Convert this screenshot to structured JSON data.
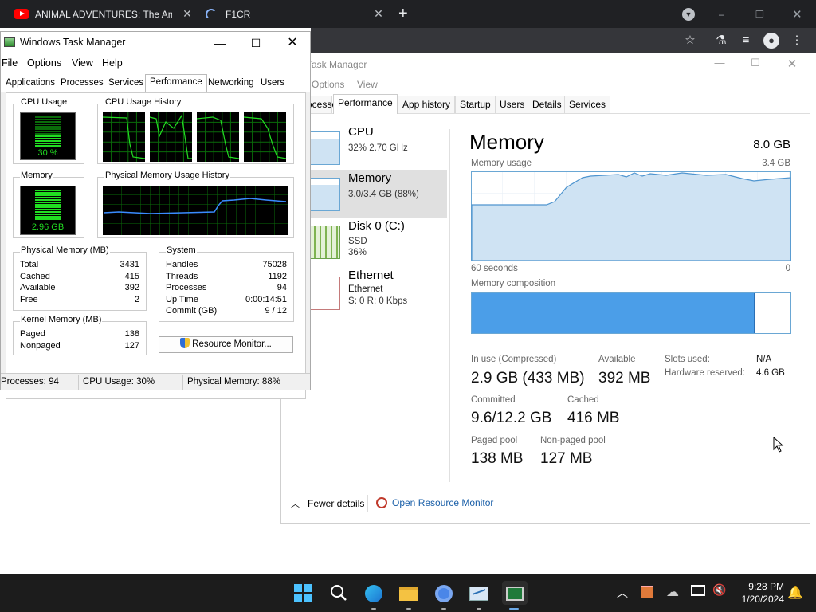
{
  "chrome": {
    "tabs": [
      {
        "label": "ANIMAL ADVENTURES: The Ama",
        "icon": "youtube-icon"
      },
      {
        "label": "F1CR",
        "icon": "loading-spinner-icon"
      }
    ],
    "new_tab_symbol": "+",
    "window_controls": [
      "–",
      "❐",
      "✕"
    ]
  },
  "ntm": {
    "title": "Task Manager",
    "menu": [
      "Options",
      "View"
    ],
    "tabs": [
      "Processes",
      "Performance",
      "App history",
      "Startup",
      "Users",
      "Details",
      "Services"
    ],
    "active_tab": "Performance",
    "sidebar": [
      {
        "name": "CPU",
        "sub1": "32%  2.70 GHz",
        "sub2": ""
      },
      {
        "name": "Memory",
        "sub1": "3.0/3.4 GB (88%)",
        "sub2": ""
      },
      {
        "name": "Disk 0 (C:)",
        "sub1": "SSD",
        "sub2": "36%"
      },
      {
        "name": "Ethernet",
        "sub1": "Ethernet",
        "sub2": "S: 0  R: 0 Kbps"
      }
    ],
    "heading": "Memory",
    "total": "8.0 GB",
    "usage_label": "Memory usage",
    "usage_max": "3.4 GB",
    "time_left": "60 seconds",
    "time_right": "0",
    "composition_label": "Memory composition",
    "composition_in_use_fraction": 0.89,
    "stats": {
      "in_use_label": "In use (Compressed)",
      "in_use": "2.9 GB (433 MB)",
      "available_label": "Available",
      "available": "392 MB",
      "slots_label": "Slots used:",
      "slots": "N/A",
      "reserved_label": "Hardware reserved:",
      "reserved": "4.6 GB",
      "committed_label": "Committed",
      "committed": "9.6/12.2 GB",
      "cached_label": "Cached",
      "cached": "416 MB",
      "paged_label": "Paged pool",
      "paged": "138 MB",
      "nonpaged_label": "Non-paged pool",
      "nonpaged": "127 MB"
    },
    "fewer_details": "Fewer details",
    "open_resmon": "Open Resource Monitor",
    "accent": "#4b9ee8"
  },
  "otm": {
    "title": "Windows Task Manager",
    "menu": [
      "File",
      "Options",
      "View",
      "Help"
    ],
    "tabs": [
      "Applications",
      "Processes",
      "Services",
      "Performance",
      "Networking",
      "Users"
    ],
    "active_tab": "Performance",
    "cpu_usage_label": "CPU Usage",
    "cpu_usage": "30 %",
    "cpu_history_label": "CPU Usage History",
    "memory_label": "Memory",
    "memory_value": "2.96 GB",
    "mem_history_label": "Physical Memory Usage History",
    "physical_label": "Physical Memory (MB)",
    "physical": [
      [
        "Total",
        "3431"
      ],
      [
        "Cached",
        "415"
      ],
      [
        "Available",
        "392"
      ],
      [
        "Free",
        "2"
      ]
    ],
    "kernel_label": "Kernel Memory (MB)",
    "kernel": [
      [
        "Paged",
        "138"
      ],
      [
        "Nonpaged",
        "127"
      ]
    ],
    "system_label": "System",
    "system": [
      [
        "Handles",
        "75028"
      ],
      [
        "Threads",
        "1192"
      ],
      [
        "Processes",
        "94"
      ],
      [
        "Up Time",
        "0:00:14:51"
      ],
      [
        "Commit (GB)",
        "9 / 12"
      ]
    ],
    "resmon_button": "Resource Monitor...",
    "status": [
      "Processes: 94",
      "CPU Usage: 30%",
      "Physical Memory: 88%"
    ],
    "graph_green": "#22dd22"
  },
  "taskbar": {
    "time": "9:28 PM",
    "date": "1/20/2024"
  }
}
